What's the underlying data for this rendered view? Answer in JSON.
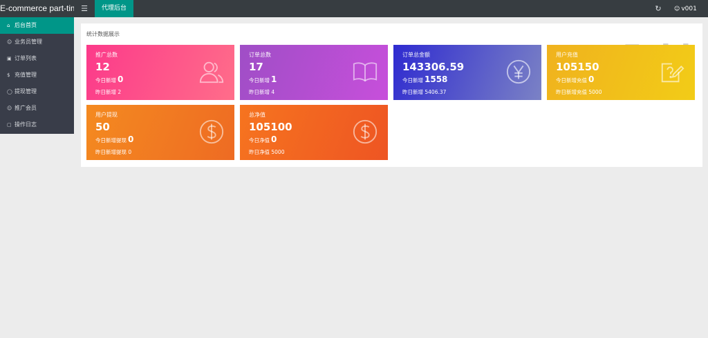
{
  "topbar": {
    "brand": "E-commerce part-time",
    "menu_icon": "hamburger-icon",
    "tab_label": "代理后台",
    "refresh_icon": "refresh-icon",
    "user_icon": "user-icon",
    "user_name": "v001"
  },
  "sidebar": {
    "items": [
      {
        "icon": "home-icon",
        "label": "后台首页",
        "active": true
      },
      {
        "icon": "user-icon",
        "label": "业务员管理"
      },
      {
        "icon": "cart-icon",
        "label": "订单列表"
      },
      {
        "icon": "dollar-icon",
        "label": "充值管理"
      },
      {
        "icon": "coin-icon",
        "label": "提现管理"
      },
      {
        "icon": "user-icon",
        "label": "推广会员"
      },
      {
        "icon": "doc-icon",
        "label": "操作日志"
      }
    ]
  },
  "main": {
    "panel_title": "统计数据展示",
    "watermark": "5zki",
    "cards": [
      {
        "title": "推广总数",
        "value": "12",
        "today_label": "今日新增",
        "today_value": "0",
        "yesterday_label": "昨日新增",
        "yesterday_value": "2",
        "icon": "users-icon"
      },
      {
        "title": "订单总数",
        "value": "17",
        "today_label": "今日新增",
        "today_value": "1",
        "yesterday_label": "昨日新增",
        "yesterday_value": "4",
        "icon": "book-icon"
      },
      {
        "title": "订单总金额",
        "value": "143306.59",
        "today_label": "今日新增",
        "today_value": "1558",
        "yesterday_label": "昨日新增",
        "yesterday_value": "5406.37",
        "icon": "yen-icon"
      },
      {
        "title": "用户充值",
        "value": "105150",
        "today_label": "今日新增充值",
        "today_value": "0",
        "yesterday_label": "昨日新增充值",
        "yesterday_value": "5000",
        "icon": "edit-icon"
      },
      {
        "title": "用户提现",
        "value": "50",
        "today_label": "今日新增提现",
        "today_value": "0",
        "yesterday_label": "昨日新增提现",
        "yesterday_value": "0",
        "icon": "dollar-circle-icon"
      },
      {
        "title": "总净值",
        "value": "105100",
        "today_label": "今日净值",
        "today_value": "0",
        "yesterday_label": "昨日净值",
        "yesterday_value": "5000",
        "icon": "dollar-circle-icon"
      }
    ]
  },
  "colors": {
    "topbar": "#373d41",
    "sidebar": "#393d49",
    "accent": "#009688",
    "background": "#ececec"
  }
}
